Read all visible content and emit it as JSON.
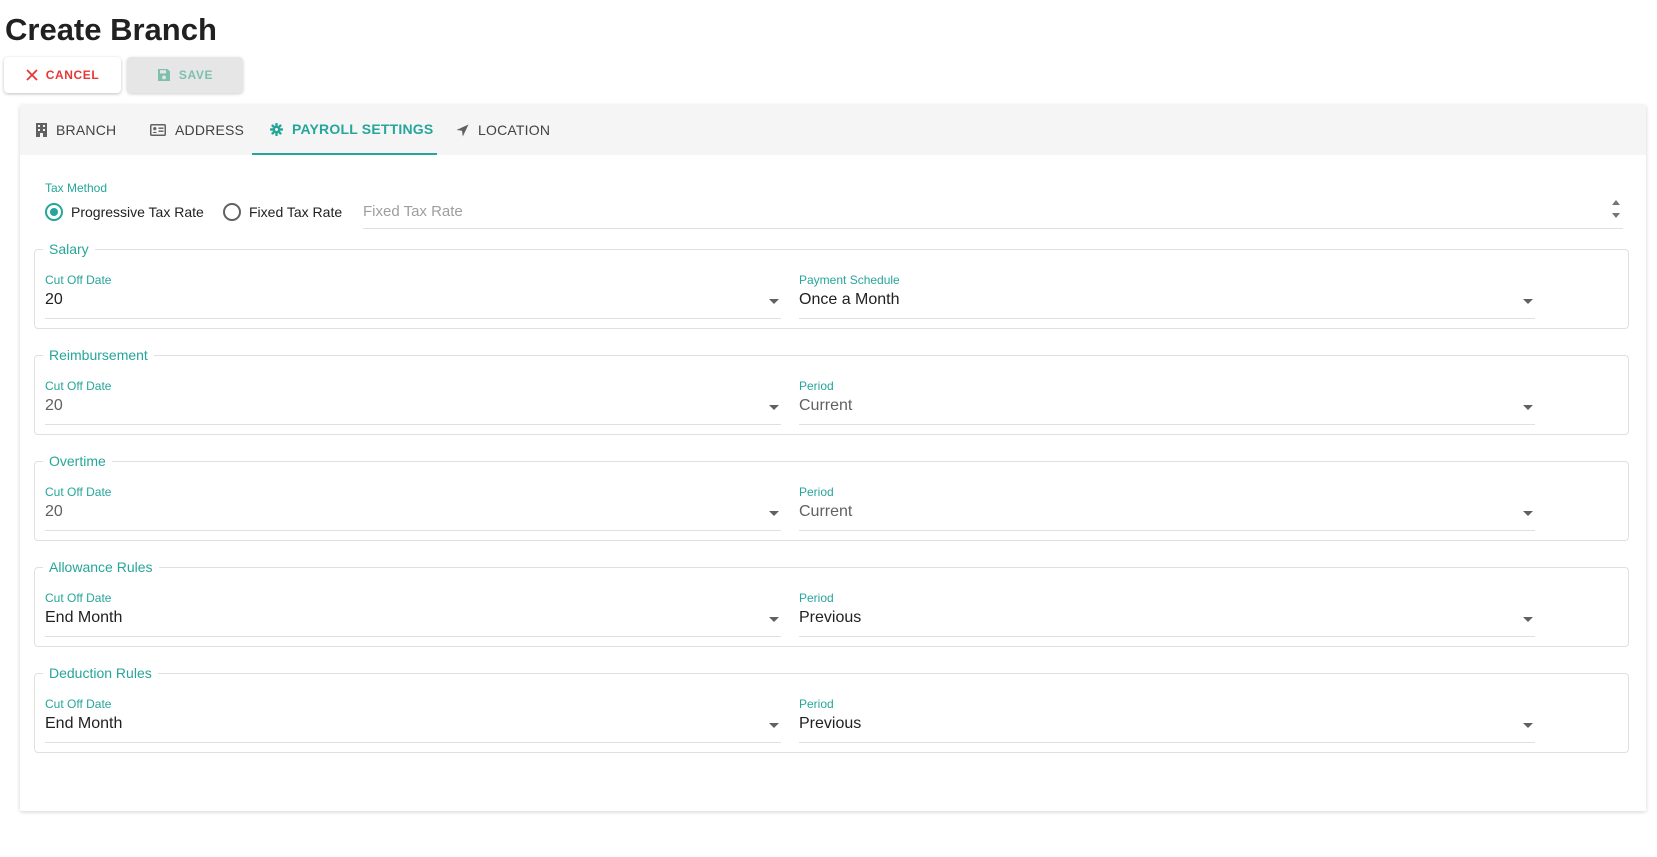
{
  "page": {
    "title": "Create Branch"
  },
  "toolbar": {
    "cancel_label": "CANCEL",
    "save_label": "SAVE"
  },
  "tabs": [
    {
      "label": "BRANCH",
      "icon": "building-icon"
    },
    {
      "label": "ADDRESS",
      "icon": "id-card-icon"
    },
    {
      "label": "PAYROLL SETTINGS",
      "icon": "gear-icon",
      "active": true
    },
    {
      "label": "LOCATION",
      "icon": "location-arrow-icon"
    }
  ],
  "tax": {
    "label": "Tax Method",
    "options": [
      {
        "label": "Progressive Tax Rate",
        "checked": true
      },
      {
        "label": "Fixed Tax Rate",
        "checked": false
      }
    ],
    "fixed_placeholder": "Fixed Tax Rate"
  },
  "sections": [
    {
      "title": "Salary",
      "left": {
        "label": "Cut Off Date",
        "value": "20"
      },
      "right": {
        "label": "Payment Schedule",
        "value": "Once a Month"
      }
    },
    {
      "title": "Reimbursement",
      "left": {
        "label": "Cut Off Date",
        "value": "20"
      },
      "right": {
        "label": "Period",
        "value": "Current"
      }
    },
    {
      "title": "Overtime",
      "left": {
        "label": "Cut Off Date",
        "value": "20"
      },
      "right": {
        "label": "Period",
        "value": "Current"
      }
    },
    {
      "title": "Allowance Rules",
      "left": {
        "label": "Cut Off Date",
        "value": "End Month"
      },
      "right": {
        "label": "Period",
        "value": "Previous"
      }
    },
    {
      "title": "Deduction Rules",
      "left": {
        "label": "Cut Off Date",
        "value": "End Month"
      },
      "right": {
        "label": "Period",
        "value": "Previous"
      }
    }
  ],
  "colors": {
    "accent": "#26a69a",
    "danger": "#e53935",
    "tabbar": "#f5f5f5"
  }
}
